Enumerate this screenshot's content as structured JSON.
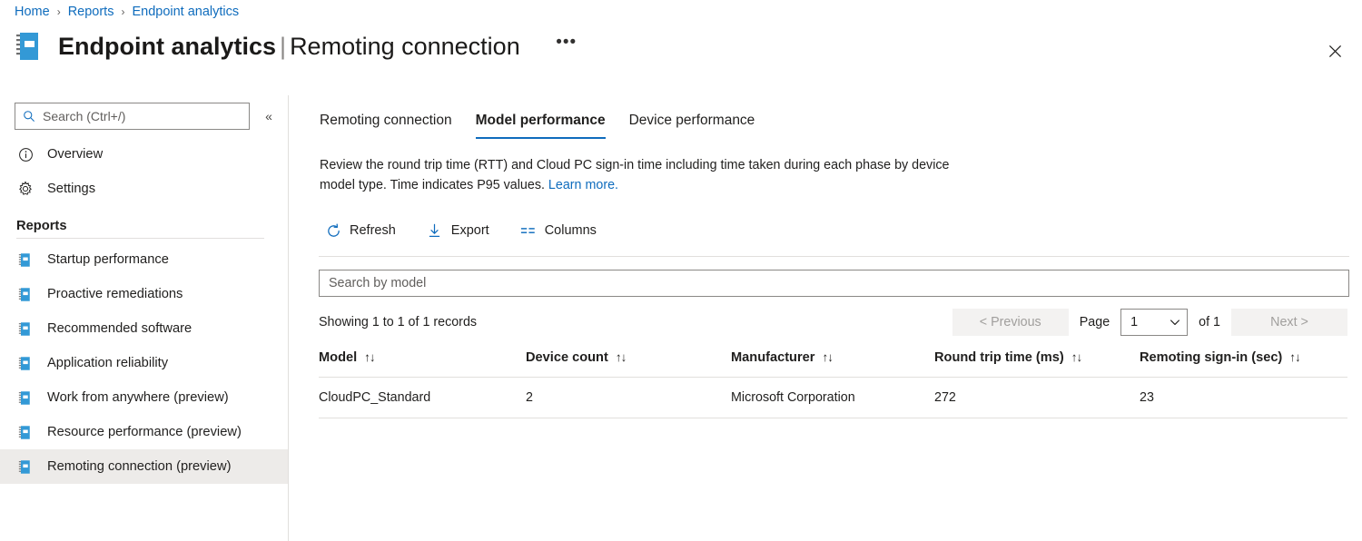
{
  "breadcrumb": {
    "items": [
      "Home",
      "Reports",
      "Endpoint analytics"
    ],
    "separator": "›"
  },
  "header": {
    "icon": "report-book-icon",
    "title_main": "Endpoint analytics",
    "title_separator": "|",
    "title_sub": "Remoting connection",
    "more_label": "•••",
    "close_label": "✕"
  },
  "sidebar": {
    "search": {
      "placeholder": "Search (Ctrl+/)",
      "value": "",
      "icon": "search-icon"
    },
    "collapse_label": "«",
    "top_items": [
      {
        "label": "Overview",
        "icon": "info-circle-icon",
        "selected": false
      },
      {
        "label": "Settings",
        "icon": "gear-icon",
        "selected": false
      }
    ],
    "group_title": "Reports",
    "report_items": [
      {
        "label": "Startup performance",
        "icon": "report-book-icon",
        "selected": false
      },
      {
        "label": "Proactive remediations",
        "icon": "report-book-icon",
        "selected": false
      },
      {
        "label": "Recommended software",
        "icon": "report-book-icon",
        "selected": false
      },
      {
        "label": "Application reliability",
        "icon": "report-book-icon",
        "selected": false
      },
      {
        "label": "Work from anywhere (preview)",
        "icon": "report-book-icon",
        "selected": false
      },
      {
        "label": "Resource performance (preview)",
        "icon": "report-book-icon",
        "selected": false
      },
      {
        "label": "Remoting connection (preview)",
        "icon": "report-book-icon",
        "selected": true
      }
    ]
  },
  "main": {
    "tabs": [
      {
        "label": "Remoting connection",
        "active": false
      },
      {
        "label": "Model performance",
        "active": true
      },
      {
        "label": "Device performance",
        "active": false
      }
    ],
    "description": {
      "text": "Review the round trip time (RTT) and Cloud PC sign-in time including time taken during each phase by device model type. Time indicates P95 values. ",
      "link_text": "Learn more."
    },
    "commands": [
      {
        "label": "Refresh",
        "icon": "refresh-icon"
      },
      {
        "label": "Export",
        "icon": "download-icon"
      },
      {
        "label": "Columns",
        "icon": "columns-icon"
      }
    ],
    "model_search": {
      "placeholder": "Search by model",
      "value": ""
    },
    "records_text": "Showing 1 to 1 of 1 records",
    "pagination": {
      "previous_label": "< Previous",
      "previous_disabled": true,
      "page_label": "Page",
      "page_value": "1",
      "page_options": [
        "1"
      ],
      "of_label": "of 1",
      "next_label": "Next >",
      "next_disabled": true,
      "caret_icon": "chevron-down-icon"
    },
    "table": {
      "sort_icon": "↑↓",
      "columns": [
        "Model",
        "Device count",
        "Manufacturer",
        "Round trip time (ms)",
        "Remoting sign-in (sec)"
      ],
      "rows": [
        {
          "model": "CloudPC_Standard",
          "device_count": "2",
          "manufacturer": "Microsoft Corporation",
          "round_trip_time_ms": "272",
          "remoting_signin_sec": "23"
        }
      ]
    }
  },
  "colors": {
    "accent": "#0f6cbd",
    "icon_blue": "#3399d6",
    "text": "#201f1e",
    "border": "#e1dfdd",
    "selected_bg": "#edebe9",
    "disabled_bg": "#f3f2f1",
    "disabled_text": "#a19f9d"
  }
}
